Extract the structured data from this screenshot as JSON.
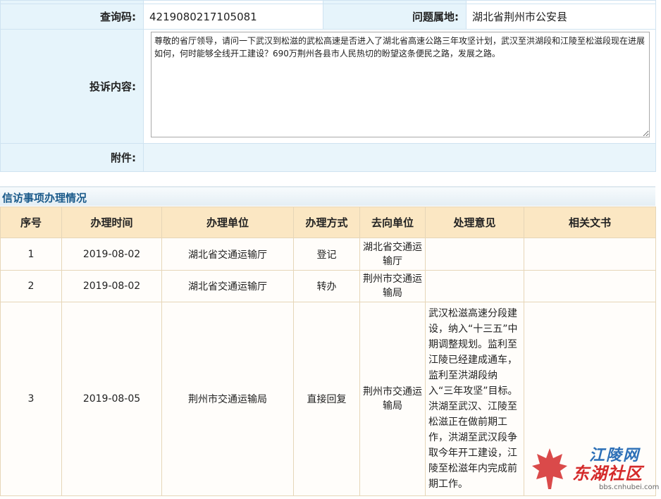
{
  "info": {
    "query_code_label": "查询码:",
    "query_code_value": "4219080217105081",
    "location_label": "问题属地:",
    "location_value": "湖北省荆州市公安县",
    "complaint_label": "投诉内容:",
    "complaint_text": "尊敬的省厅领导，请问一下武汉到松滋的武松高速是否进入了湖北省高速公路三年攻坚计划，武汉至洪湖段和江陵至松滋段现在进展如何，何时能够全线开工建设？690万荆州各县市人民热切的盼望这条便民之路，发展之路。",
    "attachment_label": "附件:",
    "attachment_value": ""
  },
  "section_title": "信访事项办理情况",
  "records": {
    "headers": [
      "序号",
      "办理时间",
      "办理单位",
      "办理方式",
      "去向单位",
      "处理意见",
      "相关文书"
    ],
    "rows": [
      {
        "no": "1",
        "date": "2019-08-02",
        "unit": "湖北省交通运输厅",
        "method": "登记",
        "dest": "湖北省交通运输厅",
        "opinion": "",
        "docs": ""
      },
      {
        "no": "2",
        "date": "2019-08-02",
        "unit": "湖北省交通运输厅",
        "method": "转办",
        "dest": "荆州市交通运输局",
        "opinion": "",
        "docs": ""
      },
      {
        "no": "3",
        "date": "2019-08-05",
        "unit": "荆州市交通运输局",
        "method": "直接回复",
        "dest": "荆州市交通运输局",
        "opinion": "武汉松滋高速分段建设，纳入“十三五”中期调整规划。监利至江陵已经建成通车，监利至洪湖段纳入“三年攻坚”目标。洪湖至武汉、江陵至松滋正在做前期工作，洪湖至武汉段争取今年开工建设，江陵至松滋年内完成前期工作。",
        "docs": ""
      }
    ]
  },
  "watermark": {
    "line1": "江陵网",
    "line2": "东湖社区",
    "line3": "bbs.cnhubei.com"
  }
}
